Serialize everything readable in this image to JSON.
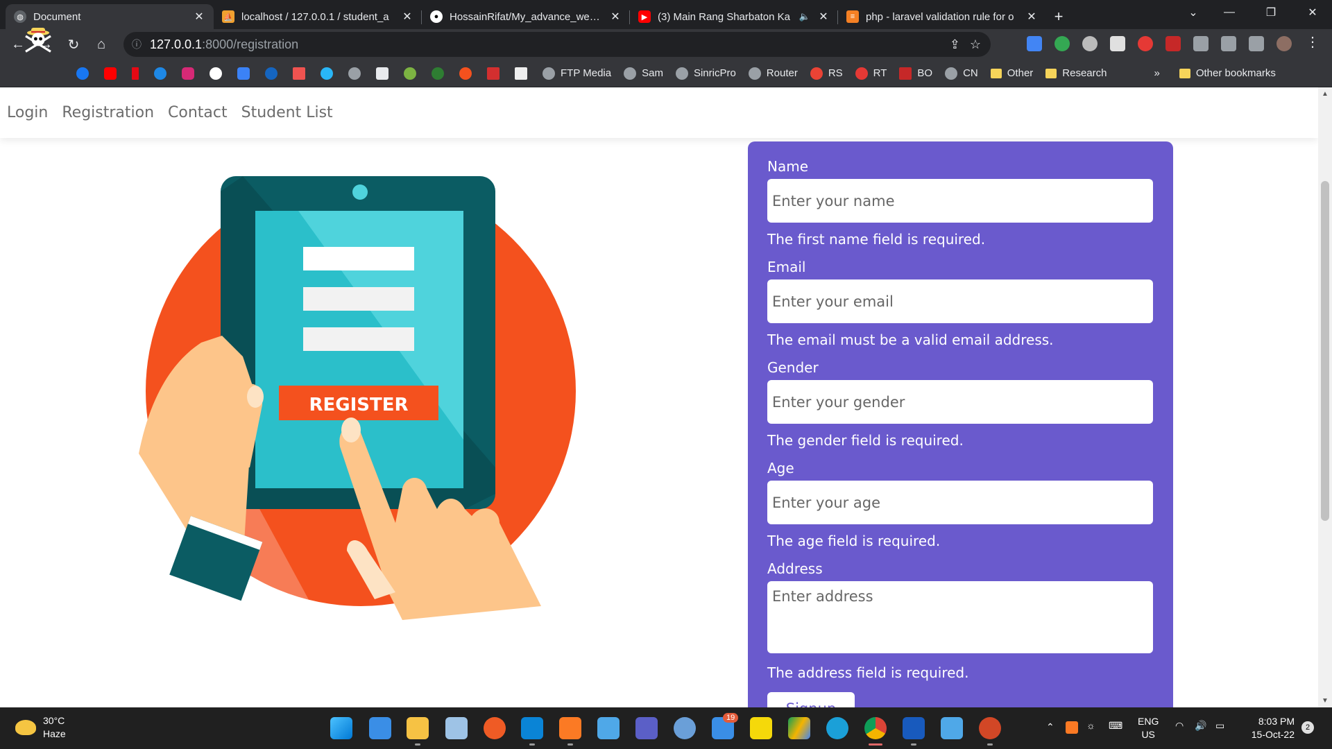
{
  "browser": {
    "tabs": [
      {
        "title": "Document",
        "active": true
      },
      {
        "title": "localhost / 127.0.0.1 / student_a"
      },
      {
        "title": "HossainRifat/My_advance_web_\\"
      },
      {
        "title": "(3) Main Rang Sharbaton Ka"
      },
      {
        "title": "php - laravel validation rule for o"
      }
    ],
    "url_host": "127.0.0.1",
    "url_path": ":8000/registration",
    "bookmarks": [
      {
        "label": "FTP Media"
      },
      {
        "label": "Sam"
      },
      {
        "label": "SinricPro"
      },
      {
        "label": "Router"
      },
      {
        "label": "RS"
      },
      {
        "label": "RT"
      },
      {
        "label": "BO"
      },
      {
        "label": "CN"
      },
      {
        "label": "Other"
      },
      {
        "label": "Research"
      }
    ],
    "more_bookmarks": "»",
    "other_bookmarks": "Other bookmarks"
  },
  "site_nav": {
    "items": [
      "Login",
      "Registration",
      "Contact",
      "Student List"
    ]
  },
  "illustration": {
    "button_text": "REGISTER"
  },
  "form": {
    "fields": [
      {
        "label": "Name",
        "placeholder": "Enter your name",
        "error": "The first name field is required."
      },
      {
        "label": "Email",
        "placeholder": "Enter your email",
        "error": "The email must be a valid email address."
      },
      {
        "label": "Gender",
        "placeholder": "Enter your gender",
        "error": "The gender field is required."
      },
      {
        "label": "Age",
        "placeholder": "Enter your age",
        "error": "The age field is required."
      }
    ],
    "address": {
      "label": "Address",
      "placeholder": "Enter address",
      "error": "The address field is required."
    },
    "submit_label": "Signup"
  },
  "taskbar": {
    "weather_temp": "30°C",
    "weather_desc": "Haze",
    "store_badge": "19",
    "lang_top": "ENG",
    "lang_bottom": "US",
    "time": "8:03 PM",
    "date": "15-Oct-22",
    "notification_count": "2"
  },
  "colors": {
    "form_bg": "#6a5acd",
    "illus_orange": "#f4511e",
    "illus_tablet": "#0b5c63",
    "illus_screen": "#4fd3dc"
  }
}
